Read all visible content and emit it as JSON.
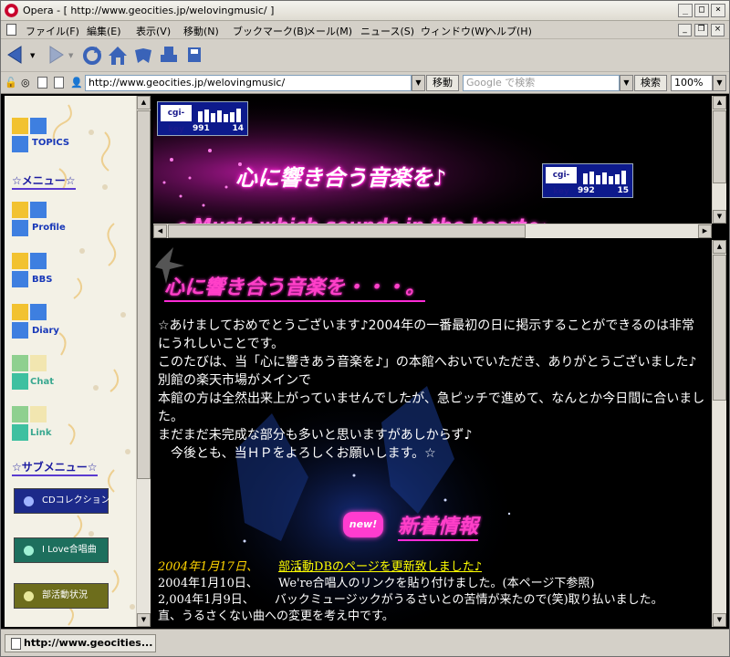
{
  "window": {
    "app_title": "Opera - [ http://www.geocities.jp/welovingmusic/ ]"
  },
  "menu": {
    "items": [
      "ファイル(F)",
      "編集(E)",
      "表示(V)",
      "移動(N)",
      "ブックマーク(B)",
      "メール(M)",
      "ニュース(S)",
      "ウィンドウ(W)",
      "ヘルプ(H)"
    ]
  },
  "address": {
    "url": "http://www.geocities.jp/welovingmusic/",
    "go_label": "移動",
    "search_placeholder": "Google で検索",
    "search_button": "検索",
    "zoom": "100%"
  },
  "left": {
    "nav": [
      {
        "label": "TOPICS"
      },
      {
        "label": "Profile"
      },
      {
        "label": "BBS"
      },
      {
        "label": "Diary"
      },
      {
        "label": "Chat"
      },
      {
        "label": "Link"
      }
    ],
    "menu_heading": "☆メニュー☆",
    "sub_heading": "☆サブメニュー☆",
    "buttons": [
      {
        "label": "CDコレクション",
        "color": "#1c2a8a"
      },
      {
        "label": "I Love合唱曲",
        "color": "#1d6f5d"
      },
      {
        "label": "部活動状況",
        "color": "#6d6d1c"
      }
    ]
  },
  "top": {
    "banner": "心に響き合う音楽を♪",
    "scroll_text": "～Music which sounds in the heart～",
    "counter1": {
      "brand": "cgi-key",
      "n1": "991",
      "n2": "14"
    },
    "counter2": {
      "brand": "cgi-key",
      "n1": "992",
      "n2": "15"
    }
  },
  "main": {
    "heading": "心に響き合う音楽を・・・。",
    "paragraphs": [
      "☆あけましておめでとうございます♪2004年の一番最初の日に掲示することができるのは非常にうれしいことです。",
      "このたびは、当「心に響きあう音楽を♪」の本館へおいでいただき、ありがとうございました♪別館の楽天市場がメインで",
      "本館の方は全然出来上がっていませんでしたが、急ピッチで進めて、なんとか今日間に合いました。",
      "まだまだ未完成な部分も多いと思いますがあしからず♪",
      "　今後とも、当ＨＰをよろしくお願いします。☆"
    ],
    "new_badge": "new!",
    "news_heading": "新着情報",
    "news": [
      {
        "date": "2004年1月17日、",
        "text": "部活動DBのページを更新致しました♪"
      },
      {
        "date": "2004年1月10日、",
        "text": "We're合唱人のリンクを貼り付けました。(本ページ下参照)"
      },
      {
        "date": "2,004年1月9日、",
        "text": "バックミュージックがうるさいとの苦情が来たので(笑)取り払いました。"
      },
      {
        "date": "",
        "text": "直、うるさくない曲への変更を考え中です。"
      }
    ]
  },
  "status": {
    "text": "http://www.geocities..."
  }
}
